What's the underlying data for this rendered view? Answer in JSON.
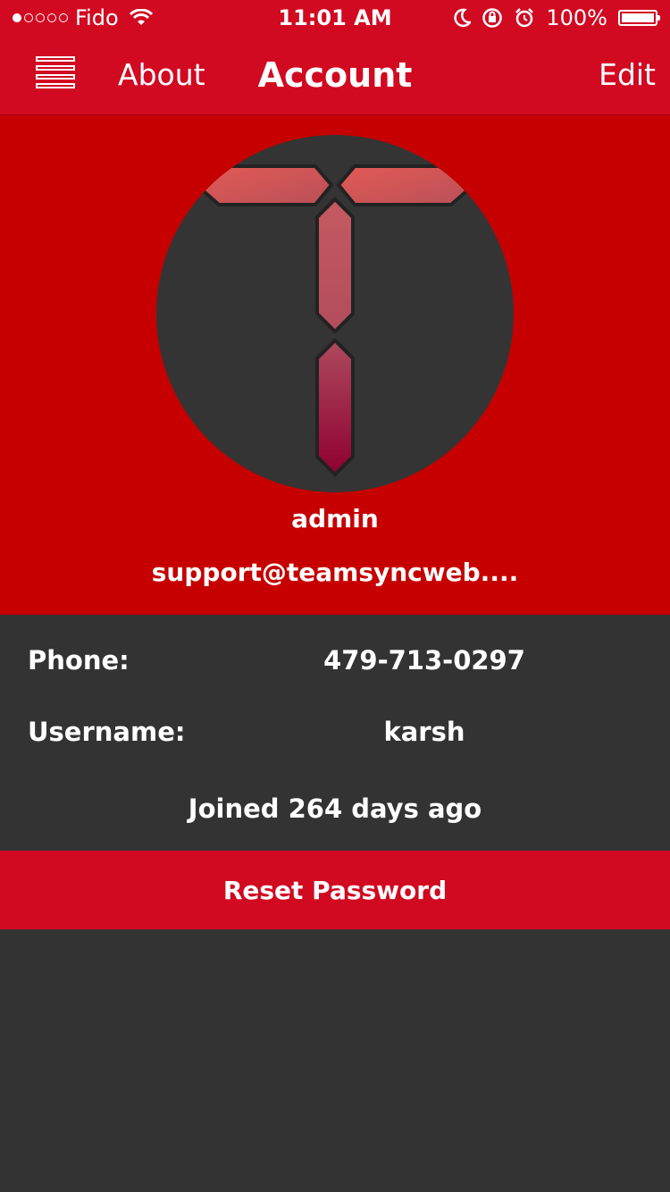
{
  "status_bar": {
    "signal_bars_filled": 1,
    "carrier": "Fido",
    "time": "11:01 AM",
    "battery": "100%"
  },
  "nav": {
    "about_label": "About",
    "title": "Account",
    "edit_label": "Edit"
  },
  "profile": {
    "name": "admin",
    "email": "support@teamsyncweb...."
  },
  "details": {
    "phone_label": "Phone:",
    "phone_value": "479-713-0297",
    "username_label": "Username:",
    "username_value": "karsh",
    "joined": "Joined 264 days ago"
  },
  "actions": {
    "reset_password_label": "Reset Password"
  },
  "colors": {
    "nav_red": "#d10a22",
    "profile_red": "#c60000",
    "dark_bg": "#333333"
  }
}
